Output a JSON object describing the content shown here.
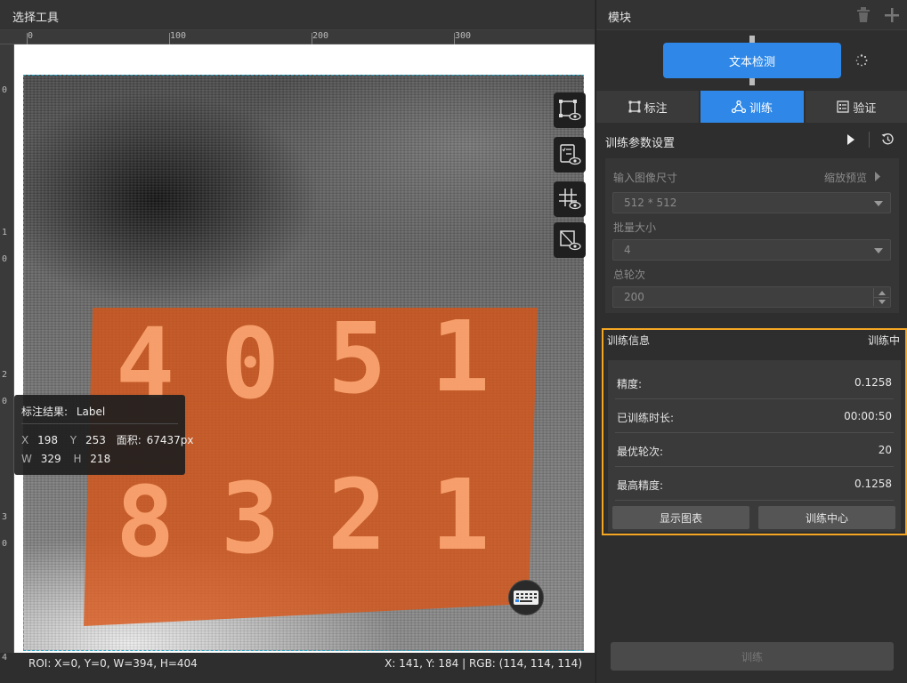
{
  "left_panel": {
    "title": "选择工具",
    "ruler_top_labels": [
      "0",
      "100",
      "200",
      "300"
    ],
    "ruler_left_labels": [
      "0",
      "1",
      "0",
      "2",
      "0",
      "3",
      "0",
      "4"
    ],
    "image_text_row1": [
      "4",
      "0",
      "5",
      "1"
    ],
    "image_text_row2": [
      "8",
      "3",
      "2",
      "1"
    ],
    "tools": [
      "roi-view-icon",
      "label-view-icon",
      "grid-view-icon",
      "mask-view-icon"
    ],
    "label_popup": {
      "result_label": "标注结果:",
      "result_value": "Label",
      "x_label": "X",
      "x_value": "198",
      "y_label": "Y",
      "y_value": "253",
      "area_label": "面积:",
      "area_value": "67437px",
      "w_label": "W",
      "w_value": "329",
      "h_label": "H",
      "h_value": "218"
    },
    "status_left": "ROI: X=0, Y=0, W=394, H=404",
    "status_right": "X: 141, Y: 184 | RGB: (114, 114, 114)"
  },
  "right_panel": {
    "title": "模块",
    "module_button": "文本检测",
    "tabs": [
      {
        "label": "标注",
        "icon": "annotate-icon",
        "active": false
      },
      {
        "label": "训练",
        "icon": "train-icon",
        "active": true
      },
      {
        "label": "验证",
        "icon": "verify-icon",
        "active": false
      }
    ],
    "params_title": "训练参数设置",
    "params": {
      "input_size_label": "输入图像尺寸",
      "scale_preview_label": "缩放预览",
      "input_size_value": "512 * 512",
      "batch_label": "批量大小",
      "batch_value": "4",
      "epochs_label": "总轮次",
      "epochs_value": "200"
    },
    "info_title": "训练信息",
    "info_status": "训练中",
    "info_rows": [
      {
        "key": "精度:",
        "value": "0.1258"
      },
      {
        "key": "已训练时长:",
        "value": "00:00:50"
      },
      {
        "key": "最优轮次:",
        "value": "20"
      },
      {
        "key": "最高精度:",
        "value": "0.1258"
      }
    ],
    "show_chart_button": "显示图表",
    "train_center_button": "训练中心",
    "train_button": "训练"
  },
  "colors": {
    "accent": "#2f88e8",
    "highlight": "#f5a623",
    "label_overlay": "#d95415"
  }
}
